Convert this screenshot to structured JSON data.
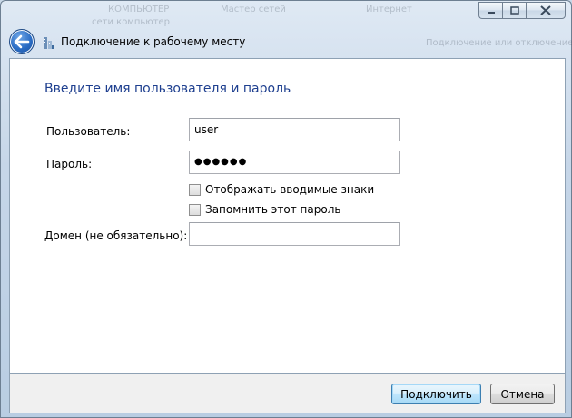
{
  "window": {
    "title": "Подключение к рабочему месту",
    "background_ghost_text": [
      "КОМПЬЮТЕР",
      "Мастер сетей",
      "Интернет",
      "сети компьютер",
      "Подключение или отключение"
    ],
    "caption": {
      "minimize": "−",
      "maximize": "▫",
      "close": "✕"
    }
  },
  "header": {
    "back_icon": "back-arrow-icon",
    "app_icon": "network-connection-icon"
  },
  "form": {
    "heading": "Введите имя пользователя и пароль",
    "user_label": "Пользователь:",
    "user_value": "user",
    "password_label": "Пароль:",
    "password_value": "●●●●●●",
    "show_chars_label": "Отображать вводимые знаки",
    "show_chars_checked": false,
    "remember_label": "Запомнить этот пароль",
    "remember_checked": false,
    "domain_label": "Домен (не обязательно):",
    "domain_value": ""
  },
  "buttons": {
    "connect": "Подключить",
    "cancel": "Отмена"
  },
  "colors": {
    "heading": "#1e3f8f",
    "accent": "#2a6cc4"
  }
}
